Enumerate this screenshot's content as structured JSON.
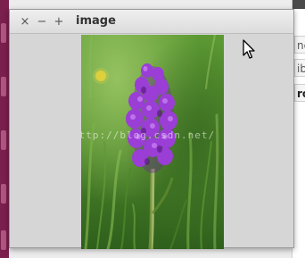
{
  "window": {
    "title": "image",
    "close_symbol": "×",
    "minimize_symbol": "−",
    "maximize_symbol": "+"
  },
  "background_window": {
    "rows": [
      "ne",
      "ib",
      "ro"
    ]
  },
  "image": {
    "watermark": "http://blog.csdn.net/"
  },
  "colors": {
    "desktop": "#7a1f4e",
    "window_bg": "#d7d7d7",
    "flower": "#8a2fc2",
    "grass": "#4d8a2a"
  },
  "icons": {
    "cursor": "arrow-cursor-icon",
    "close": "close-icon",
    "minimize": "minimize-icon",
    "maximize": "maximize-icon"
  }
}
